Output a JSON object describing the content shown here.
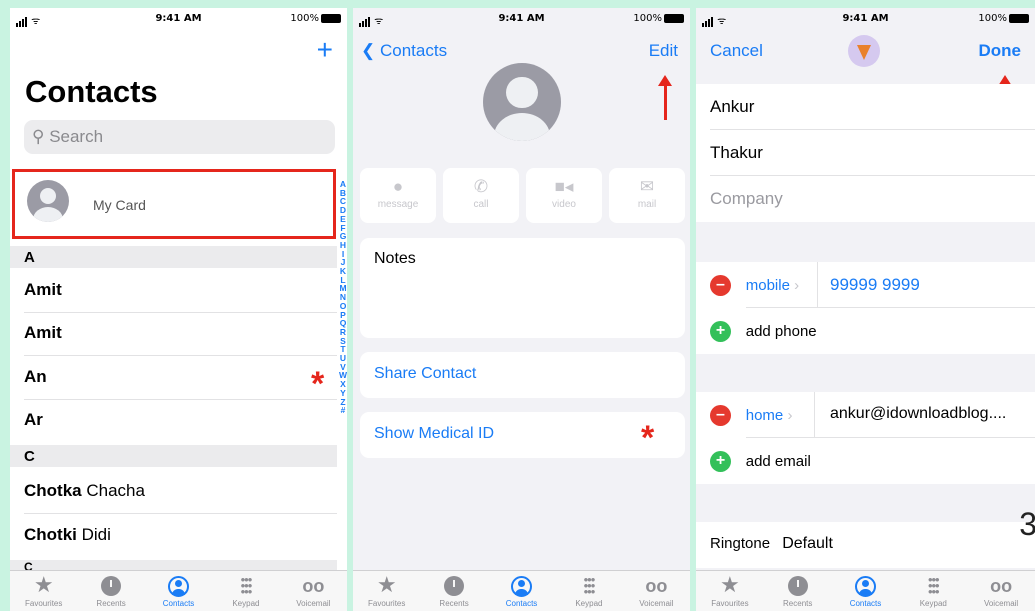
{
  "status": {
    "time": "9:41 AM",
    "battery": "100%"
  },
  "screen1": {
    "title": "Contacts",
    "search_placeholder": "Search",
    "my_card_label": "My Card",
    "sections": [
      {
        "letter": "A",
        "rows": [
          {
            "bold": "Amit",
            "rest": ""
          },
          {
            "bold": "Amit",
            "rest": ""
          },
          {
            "bold": "An",
            "rest": ""
          },
          {
            "bold": "Ar",
            "rest": ""
          }
        ]
      },
      {
        "letter": "C",
        "rows": [
          {
            "bold": "Chotka",
            "rest": " Chacha"
          },
          {
            "bold": "Chotki",
            "rest": " Didi"
          }
        ]
      }
    ],
    "index_letters": [
      "A",
      "B",
      "C",
      "D",
      "E",
      "F",
      "G",
      "H",
      "I",
      "J",
      "K",
      "L",
      "M",
      "N",
      "O",
      "P",
      "Q",
      "R",
      "S",
      "T",
      "U",
      "V",
      "W",
      "X",
      "Y",
      "Z",
      "#"
    ],
    "star_symbol": "*"
  },
  "tabs": [
    "Favourites",
    "Recents",
    "Contacts",
    "Keypad",
    "Voicemail"
  ],
  "screen2": {
    "back_label": "Contacts",
    "edit_label": "Edit",
    "actions": [
      "message",
      "call",
      "video",
      "mail"
    ],
    "notes_label": "Notes",
    "share_label": "Share Contact",
    "medical_label": "Show Medical ID",
    "star_symbol": "*"
  },
  "screen3": {
    "cancel_label": "Cancel",
    "done_label": "Done",
    "first_name": "Ankur",
    "last_name": "Thakur",
    "company_placeholder": "Company",
    "phone_label": "mobile",
    "phone_value": "99999 9999",
    "add_phone": "add phone",
    "email_label": "home",
    "email_value": "ankur@idownloadblog....",
    "add_email": "add email",
    "ringtone_label": "Ringtone",
    "ringtone_value": "Default",
    "step_number": "3"
  },
  "colors": {
    "accent": "#1a7cf5",
    "highlight": "#e5261c",
    "backdrop": "#c9f3e1"
  }
}
